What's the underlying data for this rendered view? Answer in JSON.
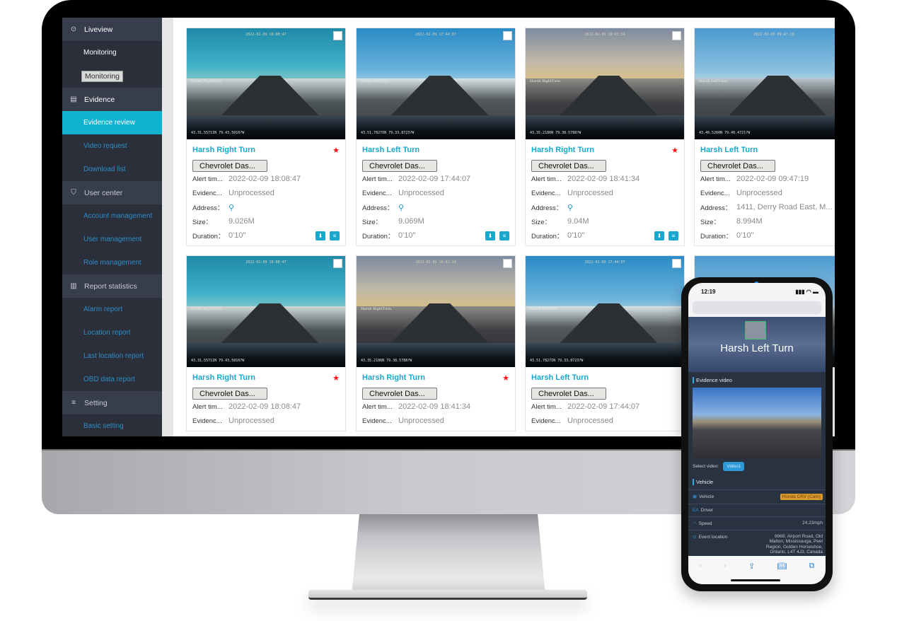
{
  "sidebar": {
    "groups": [
      {
        "label": "Liveview",
        "icon": "location-pin-icon",
        "items": [
          {
            "label": "Monitoring"
          }
        ],
        "tooltip": "Monitoring"
      },
      {
        "label": "Evidence",
        "icon": "evidence-icon",
        "items": [
          {
            "label": "Evidence review",
            "active": true
          },
          {
            "label": "Video request"
          },
          {
            "label": "Download list"
          }
        ]
      },
      {
        "label": "User center",
        "icon": "shield-icon",
        "items": [
          {
            "label": "Account management"
          },
          {
            "label": "User management"
          },
          {
            "label": "Role management"
          }
        ]
      },
      {
        "label": "Report statistics",
        "icon": "chart-icon",
        "items": [
          {
            "label": "Alarm report"
          },
          {
            "label": "Location report"
          },
          {
            "label": "Last location report"
          },
          {
            "label": "OBD data report"
          }
        ]
      },
      {
        "label": "Setting",
        "icon": "settings-sliders-icon",
        "items": [
          {
            "label": "Basic setting"
          }
        ]
      }
    ]
  },
  "labels": {
    "alert_time": "Alert tim...",
    "evidence": "Evidenc...",
    "address": "Address：",
    "size": "Size：",
    "duration": "Duration："
  },
  "cards": [
    {
      "title": "Harsh Right Turn",
      "starred": true,
      "vehicle": "Chevrolet Das...",
      "alert_time": "2022-02-09 18:08:47",
      "evidence": "Unprocessed",
      "address": "",
      "size": "9.026M",
      "duration": "0'10\"",
      "osd_label": "Harsh RightTurn",
      "osd_gps": "43.31.5571IN 79.43.5010?W",
      "scene": "teal"
    },
    {
      "title": "Harsh Left Turn",
      "starred": false,
      "vehicle": "Chevrolet Das...",
      "alert_time": "2022-02-09 17:44:07",
      "evidence": "Unprocessed",
      "address": "",
      "size": "9.069M",
      "duration": "0'10\"",
      "osd_label": "Harsh LeftTurn",
      "osd_gps": "43.51.7827IN 79.33.8723?W",
      "scene": "blue"
    },
    {
      "title": "Harsh Right Turn",
      "starred": true,
      "vehicle": "Chevrolet Das...",
      "alert_time": "2022-02-09 18:41:34",
      "evidence": "Unprocessed",
      "address": "",
      "size": "9.04M",
      "duration": "0'10\"",
      "osd_label": "Harsh RightTurn",
      "osd_gps": "43.35.2186N 79.38.5788?W",
      "scene": "sunset"
    },
    {
      "title": "Harsh Left Turn",
      "starred": false,
      "vehicle": "Chevrolet Das...",
      "alert_time": "2022-02-09 09:47:19",
      "evidence": "Unprocessed",
      "address": "1411, Derry Road East, M...",
      "size": "8.994M",
      "duration": "0'10\"",
      "osd_label": "Harsh LeftTurn",
      "osd_gps": "43.40.5260N 79.40.4721?W",
      "scene": "day"
    },
    {
      "title": "Harsh Right Turn",
      "starred": true,
      "vehicle": "Chevrolet Das...",
      "alert_time": "2022-02-09 18:08:47",
      "evidence": "Unprocessed",
      "osd_label": "Harsh RightTurn",
      "osd_gps": "43.31.5571IN 79.43.5010?W",
      "scene": "teal"
    },
    {
      "title": "Harsh Right Turn",
      "starred": true,
      "vehicle": "Chevrolet Das...",
      "alert_time": "2022-02-09 18:41:34",
      "evidence": "Unprocessed",
      "osd_label": "Harsh RightTurn",
      "osd_gps": "43.35.2186N 79.38.5788?W",
      "scene": "sunset"
    },
    {
      "title": "Harsh Left Turn",
      "starred": false,
      "vehicle": "Chevrolet Das...",
      "alert_time": "2022-02-09 17:44:07",
      "evidence": "Unprocessed",
      "osd_label": "Harsh LeftTurn",
      "osd_gps": "43.51.7827IN 79.33.8723?W",
      "scene": "blue"
    },
    {
      "title": "",
      "starred": false,
      "scene": "day",
      "osd_label": "",
      "osd_gps": ""
    }
  ],
  "phone": {
    "time": "12:19",
    "hero_title": "Harsh Left Turn",
    "evidence_video_label": "Evidence video",
    "select_video_label": "Select video:",
    "video_option": "Video1",
    "vehicle_section": "Vehicle",
    "rows": [
      {
        "label": "Vehicle",
        "icon": "car-icon",
        "value": "Honda CRV (Cam)",
        "badge": true
      },
      {
        "label": "Driver",
        "icon": "driver-icon",
        "value": ""
      },
      {
        "label": "Speed",
        "icon": "speedometer-icon",
        "value": "24.23mph"
      },
      {
        "label": "Event location",
        "icon": "location-pin-icon",
        "value": "6969, Airport Road, Old Malton, Mississauga, Peel Region, Golden Horseshoe, Ontario, L4T 4J3, Canada"
      }
    ],
    "toolbar": [
      "back-icon",
      "forward-icon",
      "share-icon",
      "bookmarks-icon",
      "tabs-icon"
    ]
  },
  "colors": {
    "accent": "#10b2d1",
    "title": "#17a7cf",
    "star": "#ff1111",
    "sidebar_bg": "#2b2f3a",
    "sidebar_group_bg": "#373d4d",
    "sidebar_link": "#2d8cc6"
  }
}
